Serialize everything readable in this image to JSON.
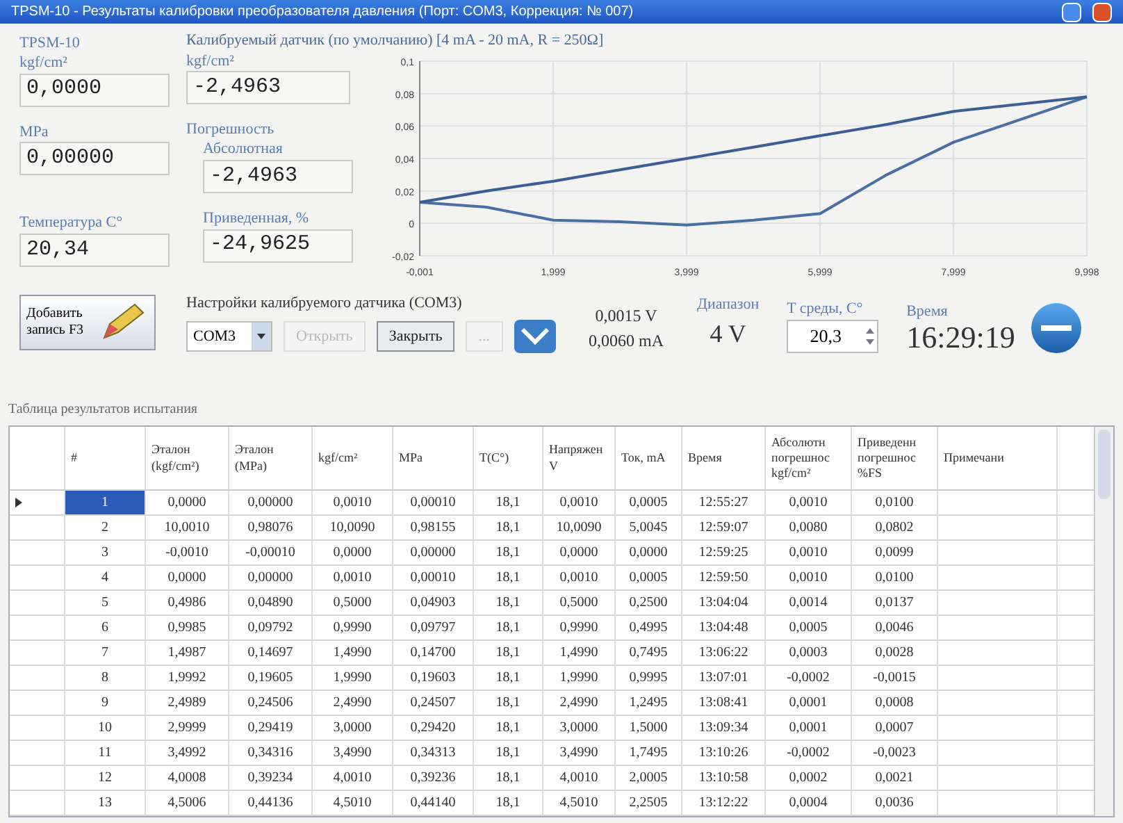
{
  "window": {
    "title": "TPSM-10 - Результаты калибровки преобразователя давления (Порт: COM3, Коррекция: № 007)"
  },
  "reference": {
    "title": "TPSM-10",
    "fields": [
      {
        "label": "kgf/cm²",
        "value": "0,0000"
      },
      {
        "label": "MPa",
        "value": "0,00000"
      }
    ],
    "temperature": {
      "label": "Температура C°",
      "value": "20,34"
    }
  },
  "add_button": {
    "label": "Добавить запись F3"
  },
  "sensor": {
    "title": "Калибруемый датчик (по умолчанию) [4 mA - 20 mA, R = 250Ω]",
    "unit": "kgf/cm²",
    "value": "-2,4963",
    "error_group": "Погрешность",
    "absolute": {
      "label": "Абсолютная",
      "value": "-2,4963"
    },
    "reduced": {
      "label": "Приведенная, %",
      "value": "-24,9625"
    }
  },
  "chart_data": {
    "type": "line",
    "x": [
      -0.001,
      1,
      2,
      3,
      4,
      5,
      6,
      7,
      8,
      9.998
    ],
    "xlim": [
      -0.001,
      9.998
    ],
    "ylim": [
      -0.02,
      0.1
    ],
    "xticks": [
      {
        "value": -0.001,
        "label": "-0,001"
      },
      {
        "value": 1.999,
        "label": "1,999"
      },
      {
        "value": 3.999,
        "label": "3,999"
      },
      {
        "value": 5.999,
        "label": "5,999"
      },
      {
        "value": 7.999,
        "label": "7,999"
      },
      {
        "value": 9.998,
        "label": "9,998"
      }
    ],
    "yticks": [
      {
        "value": -0.02,
        "label": "-0,02"
      },
      {
        "value": 0,
        "label": "0"
      },
      {
        "value": 0.02,
        "label": "0,02"
      },
      {
        "value": 0.04,
        "label": "0,04"
      },
      {
        "value": 0.06,
        "label": "0,06"
      },
      {
        "value": 0.08,
        "label": "0,08"
      },
      {
        "value": 0.1,
        "label": "0,1"
      }
    ],
    "grid": true,
    "series": [
      {
        "color": "#4a6fa5",
        "values": [
          0.013,
          0.01,
          0.002,
          0.001,
          -0.001,
          0.002,
          0.006,
          0.03,
          0.05,
          0.078
        ]
      },
      {
        "color": "#3b5f95",
        "values": [
          0.013,
          0.02,
          0.026,
          0.033,
          0.04,
          0.047,
          0.054,
          0.061,
          0.069,
          0.078
        ]
      }
    ]
  },
  "settings": {
    "title": "Настройки калибруемого датчика (COM3)",
    "controls": [
      {
        "kind": "select",
        "value": "COM3"
      },
      {
        "kind": "button",
        "label": "Открыть",
        "disabled": true
      },
      {
        "kind": "button",
        "label": "Закрыть",
        "disabled": false
      },
      {
        "kind": "button",
        "label": "...",
        "disabled": true
      },
      {
        "kind": "icon"
      }
    ]
  },
  "readings": [
    "0,0015 V",
    "0,0060 mA"
  ],
  "range": {
    "label": "Диапазон",
    "value": "4 V"
  },
  "ambient": {
    "label": "T среды, C°",
    "value": "20,3"
  },
  "clock": {
    "label": "Время",
    "value": "16:29:19"
  },
  "table": {
    "title": "Таблица результатов испытания",
    "columns": [
      "#",
      "Эталон (kgf/cm²)",
      "Эталон (MPa)",
      "kgf/cm²",
      "MPa",
      "T(C°)",
      "Напряжен V",
      "Ток, mA",
      "Время",
      "Абсолютн погрешнос kgf/cm²",
      "Приведенн погрешнос %FS",
      "Примечани"
    ],
    "rows": [
      {
        "selected": true,
        "cells": [
          "1",
          "0,0000",
          "0,00000",
          "0,0010",
          "0,00010",
          "18,1",
          "0,0010",
          "0,0005",
          "12:55:27",
          "0,0010",
          "0,0100"
        ]
      },
      {
        "selected": false,
        "cells": [
          "2",
          "10,0010",
          "0,98076",
          "10,0090",
          "0,98155",
          "18,1",
          "10,0090",
          "5,0045",
          "12:59:07",
          "0,0080",
          "0,0802"
        ]
      },
      {
        "selected": false,
        "cells": [
          "3",
          "-0,0010",
          "-0,00010",
          "0,0000",
          "0,00000",
          "18,1",
          "0,0000",
          "0,0000",
          "12:59:25",
          "0,0010",
          "0,0099"
        ]
      },
      {
        "selected": false,
        "cells": [
          "4",
          "0,0000",
          "0,00000",
          "0,0010",
          "0,00010",
          "18,1",
          "0,0010",
          "0,0005",
          "12:59:50",
          "0,0010",
          "0,0100"
        ]
      },
      {
        "selected": false,
        "cells": [
          "5",
          "0,4986",
          "0,04890",
          "0,5000",
          "0,04903",
          "18,1",
          "0,5000",
          "0,2500",
          "13:04:04",
          "0,0014",
          "0,0137"
        ]
      },
      {
        "selected": false,
        "cells": [
          "6",
          "0,9985",
          "0,09792",
          "0,9990",
          "0,09797",
          "18,1",
          "0,9990",
          "0,4995",
          "13:04:48",
          "0,0005",
          "0,0046"
        ]
      },
      {
        "selected": false,
        "cells": [
          "7",
          "1,4987",
          "0,14697",
          "1,4990",
          "0,14700",
          "18,1",
          "1,4990",
          "0,7495",
          "13:06:22",
          "0,0003",
          "0,0028"
        ]
      },
      {
        "selected": false,
        "cells": [
          "8",
          "1,9992",
          "0,19605",
          "1,9990",
          "0,19603",
          "18,1",
          "1,9990",
          "0,9995",
          "13:07:01",
          "-0,0002",
          "-0,0015"
        ]
      },
      {
        "selected": false,
        "cells": [
          "9",
          "2,4989",
          "0,24506",
          "2,4990",
          "0,24507",
          "18,1",
          "2,4990",
          "1,2495",
          "13:08:41",
          "0,0001",
          "0,0008"
        ]
      },
      {
        "selected": false,
        "cells": [
          "10",
          "2,9999",
          "0,29419",
          "3,0000",
          "0,29420",
          "18,1",
          "3,0000",
          "1,5000",
          "13:09:34",
          "0,0001",
          "0,0007"
        ]
      },
      {
        "selected": false,
        "cells": [
          "11",
          "3,4992",
          "0,34316",
          "3,4990",
          "0,34313",
          "18,1",
          "3,4990",
          "1,7495",
          "13:10:26",
          "-0,0002",
          "-0,0023"
        ]
      },
      {
        "selected": false,
        "cells": [
          "12",
          "4,0008",
          "0,39234",
          "4,0010",
          "0,39236",
          "18,1",
          "4,0010",
          "2,0005",
          "13:10:58",
          "0,0002",
          "0,0021"
        ]
      },
      {
        "selected": false,
        "cells": [
          "13",
          "4,5006",
          "0,44136",
          "4,5010",
          "0,44140",
          "18,1",
          "4,5010",
          "2,2505",
          "13:12:22",
          "0,0004",
          "0,0036"
        ]
      }
    ]
  }
}
